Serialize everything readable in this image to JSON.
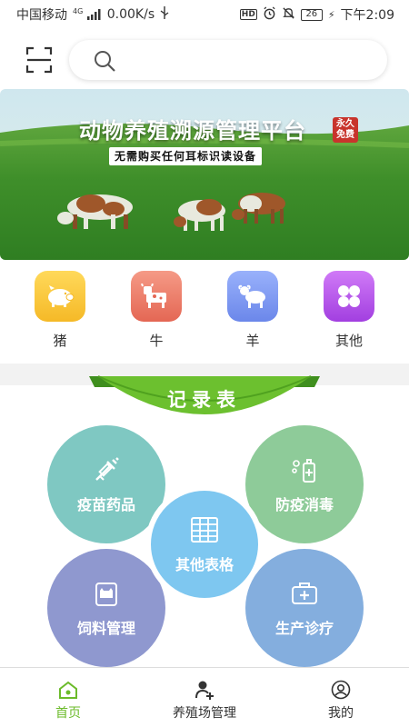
{
  "status_bar": {
    "carrier": "中国移动",
    "network": "4G",
    "speed": "0.00K/s",
    "hd": "HD",
    "battery": "26",
    "time": "下午2:09"
  },
  "search": {
    "placeholder": ""
  },
  "banner": {
    "title": "动物养殖溯源管理平台",
    "badge": "永久免费",
    "subtitle": "无需购买任何耳标识读设备"
  },
  "categories": [
    {
      "label": "猪",
      "icon": "pig-icon",
      "color": "#f7c533"
    },
    {
      "label": "牛",
      "icon": "cow-icon",
      "color": "#f07a6a"
    },
    {
      "label": "羊",
      "icon": "sheep-icon",
      "color": "#7c9af3"
    },
    {
      "label": "其他",
      "icon": "grid-icon",
      "color": "#b550e6"
    }
  ],
  "records": {
    "title": "记录表",
    "items": [
      {
        "label": "疫苗药品",
        "icon": "syringe-icon",
        "color": "#7fc8c2"
      },
      {
        "label": "防疫消毒",
        "icon": "disinfect-icon",
        "color": "#8ecb99"
      },
      {
        "label": "其他表格",
        "icon": "table-icon",
        "color": "#7ec7f0"
      },
      {
        "label": "饲料管理",
        "icon": "feed-icon",
        "color": "#8f98cf"
      },
      {
        "label": "生产诊疗",
        "icon": "medkit-icon",
        "color": "#84aede"
      }
    ]
  },
  "tabbar": {
    "items": [
      {
        "label": "首页",
        "active": true
      },
      {
        "label": "养殖场管理",
        "active": false
      },
      {
        "label": "我的",
        "active": false
      }
    ]
  },
  "colors": {
    "accent_green": "#6bbb2a",
    "ribbon_green": "#5eb72a"
  }
}
